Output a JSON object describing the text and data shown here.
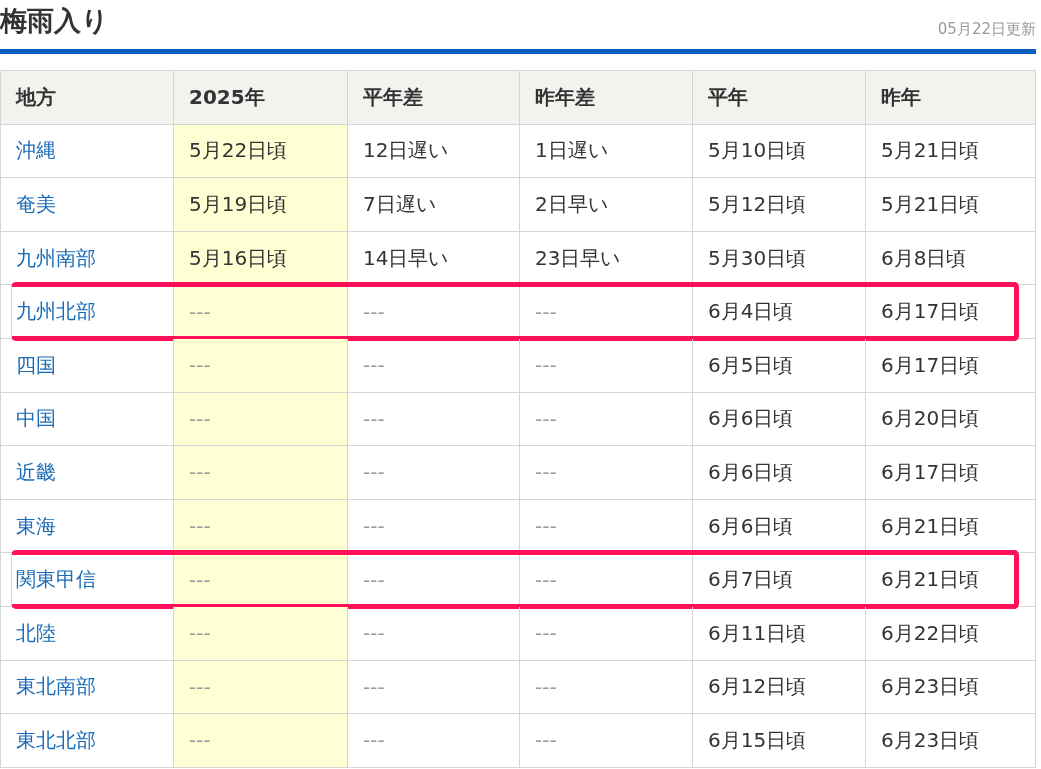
{
  "title": "梅雨入り",
  "updated": "05月22日更新",
  "table": {
    "columns": [
      "地方",
      "2025年",
      "平年差",
      "昨年差",
      "平年",
      "昨年"
    ],
    "rows": [
      {
        "region": "沖縄",
        "y2025": "5月22日頃",
        "vs_normal": "12日遅い",
        "vs_last": "1日遅い",
        "normal": "5月10日頃",
        "last_year": "5月21日頃",
        "announced": true,
        "highlighted": false
      },
      {
        "region": "奄美",
        "y2025": "5月19日頃",
        "vs_normal": "7日遅い",
        "vs_last": "2日早い",
        "normal": "5月12日頃",
        "last_year": "5月21日頃",
        "announced": true,
        "highlighted": false
      },
      {
        "region": "九州南部",
        "y2025": "5月16日頃",
        "vs_normal": "14日早い",
        "vs_last": "23日早い",
        "normal": "5月30日頃",
        "last_year": "6月8日頃",
        "announced": true,
        "highlighted": false
      },
      {
        "region": "九州北部",
        "y2025": "---",
        "vs_normal": "---",
        "vs_last": "---",
        "normal": "6月4日頃",
        "last_year": "6月17日頃",
        "announced": false,
        "highlighted": true
      },
      {
        "region": "四国",
        "y2025": "---",
        "vs_normal": "---",
        "vs_last": "---",
        "normal": "6月5日頃",
        "last_year": "6月17日頃",
        "announced": false,
        "highlighted": false
      },
      {
        "region": "中国",
        "y2025": "---",
        "vs_normal": "---",
        "vs_last": "---",
        "normal": "6月6日頃",
        "last_year": "6月20日頃",
        "announced": false,
        "highlighted": false
      },
      {
        "region": "近畿",
        "y2025": "---",
        "vs_normal": "---",
        "vs_last": "---",
        "normal": "6月6日頃",
        "last_year": "6月17日頃",
        "announced": false,
        "highlighted": false
      },
      {
        "region": "東海",
        "y2025": "---",
        "vs_normal": "---",
        "vs_last": "---",
        "normal": "6月6日頃",
        "last_year": "6月21日頃",
        "announced": false,
        "highlighted": false
      },
      {
        "region": "関東甲信",
        "y2025": "---",
        "vs_normal": "---",
        "vs_last": "---",
        "normal": "6月7日頃",
        "last_year": "6月21日頃",
        "announced": false,
        "highlighted": true
      },
      {
        "region": "北陸",
        "y2025": "---",
        "vs_normal": "---",
        "vs_last": "---",
        "normal": "6月11日頃",
        "last_year": "6月22日頃",
        "announced": false,
        "highlighted": false
      },
      {
        "region": "東北南部",
        "y2025": "---",
        "vs_normal": "---",
        "vs_last": "---",
        "normal": "6月12日頃",
        "last_year": "6月23日頃",
        "announced": false,
        "highlighted": false
      },
      {
        "region": "東北北部",
        "y2025": "---",
        "vs_normal": "---",
        "vs_last": "---",
        "normal": "6月15日頃",
        "last_year": "6月23日頃",
        "announced": false,
        "highlighted": false
      }
    ]
  }
}
